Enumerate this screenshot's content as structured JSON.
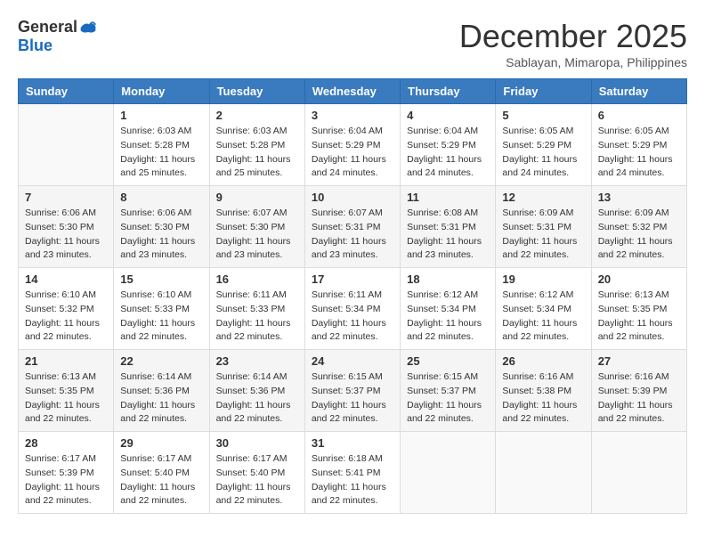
{
  "header": {
    "logo_general": "General",
    "logo_blue": "Blue",
    "month_title": "December 2025",
    "subtitle": "Sablayan, Mimaropa, Philippines"
  },
  "calendar": {
    "days_of_week": [
      "Sunday",
      "Monday",
      "Tuesday",
      "Wednesday",
      "Thursday",
      "Friday",
      "Saturday"
    ],
    "weeks": [
      [
        {
          "day": "",
          "info": ""
        },
        {
          "day": "1",
          "info": "Sunrise: 6:03 AM\nSunset: 5:28 PM\nDaylight: 11 hours\nand 25 minutes."
        },
        {
          "day": "2",
          "info": "Sunrise: 6:03 AM\nSunset: 5:28 PM\nDaylight: 11 hours\nand 25 minutes."
        },
        {
          "day": "3",
          "info": "Sunrise: 6:04 AM\nSunset: 5:29 PM\nDaylight: 11 hours\nand 24 minutes."
        },
        {
          "day": "4",
          "info": "Sunrise: 6:04 AM\nSunset: 5:29 PM\nDaylight: 11 hours\nand 24 minutes."
        },
        {
          "day": "5",
          "info": "Sunrise: 6:05 AM\nSunset: 5:29 PM\nDaylight: 11 hours\nand 24 minutes."
        },
        {
          "day": "6",
          "info": "Sunrise: 6:05 AM\nSunset: 5:29 PM\nDaylight: 11 hours\nand 24 minutes."
        }
      ],
      [
        {
          "day": "7",
          "info": "Sunrise: 6:06 AM\nSunset: 5:30 PM\nDaylight: 11 hours\nand 23 minutes."
        },
        {
          "day": "8",
          "info": "Sunrise: 6:06 AM\nSunset: 5:30 PM\nDaylight: 11 hours\nand 23 minutes."
        },
        {
          "day": "9",
          "info": "Sunrise: 6:07 AM\nSunset: 5:30 PM\nDaylight: 11 hours\nand 23 minutes."
        },
        {
          "day": "10",
          "info": "Sunrise: 6:07 AM\nSunset: 5:31 PM\nDaylight: 11 hours\nand 23 minutes."
        },
        {
          "day": "11",
          "info": "Sunrise: 6:08 AM\nSunset: 5:31 PM\nDaylight: 11 hours\nand 23 minutes."
        },
        {
          "day": "12",
          "info": "Sunrise: 6:09 AM\nSunset: 5:31 PM\nDaylight: 11 hours\nand 22 minutes."
        },
        {
          "day": "13",
          "info": "Sunrise: 6:09 AM\nSunset: 5:32 PM\nDaylight: 11 hours\nand 22 minutes."
        }
      ],
      [
        {
          "day": "14",
          "info": "Sunrise: 6:10 AM\nSunset: 5:32 PM\nDaylight: 11 hours\nand 22 minutes."
        },
        {
          "day": "15",
          "info": "Sunrise: 6:10 AM\nSunset: 5:33 PM\nDaylight: 11 hours\nand 22 minutes."
        },
        {
          "day": "16",
          "info": "Sunrise: 6:11 AM\nSunset: 5:33 PM\nDaylight: 11 hours\nand 22 minutes."
        },
        {
          "day": "17",
          "info": "Sunrise: 6:11 AM\nSunset: 5:34 PM\nDaylight: 11 hours\nand 22 minutes."
        },
        {
          "day": "18",
          "info": "Sunrise: 6:12 AM\nSunset: 5:34 PM\nDaylight: 11 hours\nand 22 minutes."
        },
        {
          "day": "19",
          "info": "Sunrise: 6:12 AM\nSunset: 5:34 PM\nDaylight: 11 hours\nand 22 minutes."
        },
        {
          "day": "20",
          "info": "Sunrise: 6:13 AM\nSunset: 5:35 PM\nDaylight: 11 hours\nand 22 minutes."
        }
      ],
      [
        {
          "day": "21",
          "info": "Sunrise: 6:13 AM\nSunset: 5:35 PM\nDaylight: 11 hours\nand 22 minutes."
        },
        {
          "day": "22",
          "info": "Sunrise: 6:14 AM\nSunset: 5:36 PM\nDaylight: 11 hours\nand 22 minutes."
        },
        {
          "day": "23",
          "info": "Sunrise: 6:14 AM\nSunset: 5:36 PM\nDaylight: 11 hours\nand 22 minutes."
        },
        {
          "day": "24",
          "info": "Sunrise: 6:15 AM\nSunset: 5:37 PM\nDaylight: 11 hours\nand 22 minutes."
        },
        {
          "day": "25",
          "info": "Sunrise: 6:15 AM\nSunset: 5:37 PM\nDaylight: 11 hours\nand 22 minutes."
        },
        {
          "day": "26",
          "info": "Sunrise: 6:16 AM\nSunset: 5:38 PM\nDaylight: 11 hours\nand 22 minutes."
        },
        {
          "day": "27",
          "info": "Sunrise: 6:16 AM\nSunset: 5:39 PM\nDaylight: 11 hours\nand 22 minutes."
        }
      ],
      [
        {
          "day": "28",
          "info": "Sunrise: 6:17 AM\nSunset: 5:39 PM\nDaylight: 11 hours\nand 22 minutes."
        },
        {
          "day": "29",
          "info": "Sunrise: 6:17 AM\nSunset: 5:40 PM\nDaylight: 11 hours\nand 22 minutes."
        },
        {
          "day": "30",
          "info": "Sunrise: 6:17 AM\nSunset: 5:40 PM\nDaylight: 11 hours\nand 22 minutes."
        },
        {
          "day": "31",
          "info": "Sunrise: 6:18 AM\nSunset: 5:41 PM\nDaylight: 11 hours\nand 22 minutes."
        },
        {
          "day": "",
          "info": ""
        },
        {
          "day": "",
          "info": ""
        },
        {
          "day": "",
          "info": ""
        }
      ]
    ]
  }
}
